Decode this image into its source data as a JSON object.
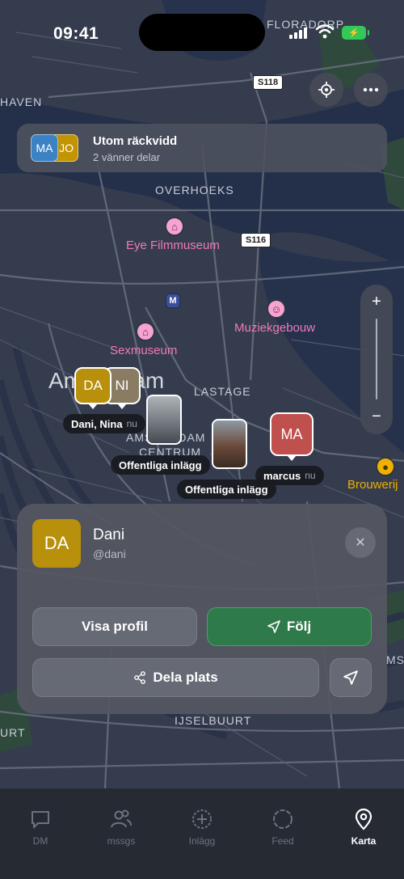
{
  "status_bar": {
    "time": "09:41"
  },
  "map": {
    "labels": {
      "floradorp": "FLORADORP",
      "haven": "HAVEN",
      "overhoeks": "OVERHOEKS",
      "lastage": "LASTAGE",
      "ijselbuurt": "IJSELBUURT",
      "centrum_1": "AMSTERDAM",
      "centrum_2": "CENTRUM",
      "amsterdam": "Amsterdam",
      "urt": "URT",
      "ms": "MS"
    },
    "roads": {
      "s118": "S118",
      "s116": "S116"
    },
    "pois": {
      "eye": "Eye Filmmuseum",
      "muziekgebouw": "Muziekgebouw",
      "sexmuseum": "Sexmuseum",
      "brouwerij": "Brouwerij"
    }
  },
  "banner": {
    "title": "Utom räckvidd",
    "subtitle": "2 vänner delar",
    "avatars": [
      "MA",
      "JO"
    ]
  },
  "markers": {
    "group_avatars": [
      "DA",
      "NI"
    ],
    "group_label": "Dani, Nina",
    "group_time": "nu",
    "post_label_1": "Offentliga inlägg",
    "post_label_2": "Offentliga inlägg",
    "marcus_avatar": "MA",
    "marcus_label": "marcus",
    "marcus_time": "nu"
  },
  "card": {
    "avatar": "DA",
    "name": "Dani",
    "handle": "@dani",
    "view_profile": "Visa profil",
    "follow": "Följ",
    "share_location": "Dela plats"
  },
  "tabs": [
    {
      "label": "DM",
      "icon": "chat-bubble-icon"
    },
    {
      "label": "mssgs",
      "icon": "people-icon"
    },
    {
      "label": "Inlägg",
      "icon": "plus-circle-icon"
    },
    {
      "label": "Feed",
      "icon": "circle-icon"
    },
    {
      "label": "Karta",
      "icon": "map-pin-icon",
      "active": true
    }
  ],
  "colors": {
    "dani": "#b8900c",
    "nina": "#8a7c62",
    "marcus": "#c0504d",
    "ma_banner": "#3b82c4",
    "jo_banner": "#c29400",
    "follow_green": "#2f7a4a"
  }
}
